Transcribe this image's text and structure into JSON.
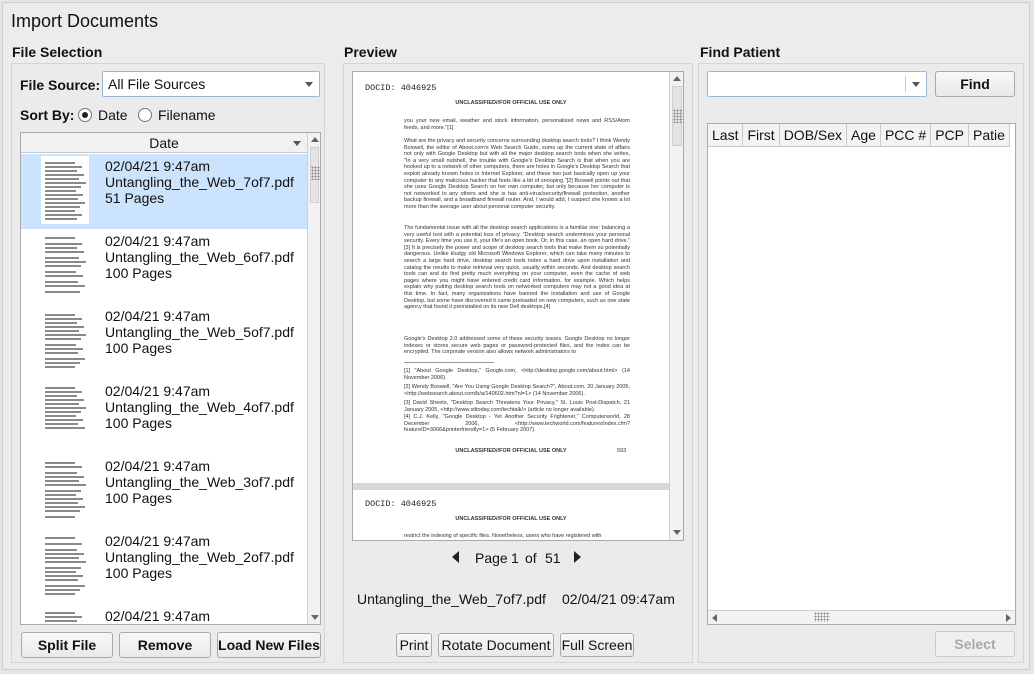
{
  "window": {
    "title": "Import Documents"
  },
  "file_selection": {
    "title": "File Selection",
    "source_label": "File Source:",
    "source_value": "All File Sources",
    "sort_label": "Sort By:",
    "sort_options": [
      "Date",
      "Filename"
    ],
    "sort_selected": "Date",
    "list_header": "Date",
    "files": [
      {
        "date": "02/04/21 9:47am",
        "name": "Untangling_the_Web_7of7.pdf",
        "pages": "51 Pages"
      },
      {
        "date": "02/04/21 9:47am",
        "name": "Untangling_the_Web_6of7.pdf",
        "pages": "100 Pages"
      },
      {
        "date": "02/04/21 9:47am",
        "name": "Untangling_the_Web_5of7.pdf",
        "pages": "100 Pages"
      },
      {
        "date": "02/04/21 9:47am",
        "name": "Untangling_the_Web_4of7.pdf",
        "pages": "100 Pages"
      },
      {
        "date": "02/04/21 9:47am",
        "name": "Untangling_the_Web_3of7.pdf",
        "pages": "100 Pages"
      },
      {
        "date": "02/04/21 9:47am",
        "name": "Untangling_the_Web_2of7.pdf",
        "pages": "100 Pages"
      },
      {
        "date": "02/04/21 9:47am",
        "name": "",
        "pages": ""
      }
    ],
    "buttons": {
      "split": "Split File",
      "remove": "Remove",
      "load": "Load New Files"
    }
  },
  "preview": {
    "title": "Preview",
    "docid": "DOCID: 4046925",
    "classification": "UNCLASSIFIED//FOR OFFICIAL USE ONLY",
    "p_intro": "you your new email, weather and stock information, personalized news and RSS/Atom feeds, and more.\"[1]",
    "p1": "What are the privacy and security concerns surrounding desktop search tools? I think Wendy Boswell, the editor of About.com's Web Search Guide, sums up the current state of affairs not only with Google Desktop but with all the major desktop search tools when she writes, \"In a very small nutshell, the trouble with Google's Desktop Search is that when you are hooked up to a network of other computers, there are holes in Google's Desktop Search that exploit already known holes in Internet Explorer, and these two just basically open up your computer to any malicious hacker that feels like a bit of snooping.\"[2] Boswell points out that she uses Google Desktop Search on her own computer, but only because her computer is not networked to any others and she is has anti-virus/security/firewall protection, another backup firewall, and a broadband firewall router. And, I would add, I suspect she knows a lot more than the average user about personal computer security.",
    "p2": "The fundamental issue with all the desktop search applications is a familiar one: balancing a very useful tool with a potential loss of privacy. \"Desktop search undermines your personal security. Every time you use it, your life's an open book. Or, in this case, an open hard drive.\"[3] It is precisely the power and scope of desktop search tools that make them so potentially dangerous. Unlike kludgy old Microsoft Windows Explorer, which can take many minutes to search a large hard drive, desktop search tools index a hard drive upon installation and catalog the results to make retrieval very quick, usually within seconds. And desktop search tools can and do find pretty much everything on your computer, even the cache of web pages where you might have entered credit card information, for example. Which helps explain why putting desktop search tools on networked computers may not a good idea at this time. In fact, many organizations have banned the installation and use of Google Desktop, but some have discovered it came preloaded on new computers, such as one state agency that found it preinstalled on its new Dell desktops.[4]",
    "p3": "Google's Desktop 2.0 addressed some of these security issues. Google Desktop no longer indexes or stores secure web pages or password-protected files, and the index can be encrypted. The corporate version also allows network administrators to",
    "footnotes": [
      "[1] \"About Google Desktop,\" Google.com, <http://desktop.google.com/about.html> (14 November 2006).",
      "[2] Wendy Boswell, \"Are You Using Google Desktop Search?\", About.com, 20 January 2005, <http://websearch.about.com/b/a/140602.htm?nl=1> (14 November 2006).",
      "[3] David Sheets, \"Desktop Search Threatens Your Privacy,\" St. Louis Post-Dispatch, 21 January 2005, <http://www.stltoday.com/techtalk/> (article no longer available).",
      "[4] C.J. Kelly, \"Google Desktop - Yet Another Security Frightener,\" Computerworld, 28 December 2006, <http://www.techworld.com/features/index.cfm?featureID=3066&printerfriendly=1> (5 February 2007)."
    ],
    "page_number": "593",
    "page2_text": "restrict the indexing of specific files. Nonetheless, users who have registered with",
    "page_label": "Page",
    "page_current": "1",
    "page_of": "of",
    "page_total": "51",
    "filename": "Untangling_the_Web_7of7.pdf",
    "timestamp": "02/04/21 09:47am",
    "buttons": {
      "print": "Print",
      "rotate": "Rotate Document",
      "fullscreen": "Full Screen"
    }
  },
  "find_patient": {
    "title": "Find Patient",
    "search_value": "",
    "find_label": "Find",
    "columns": [
      "Last",
      "First",
      "DOB/Sex",
      "Age",
      "PCC #",
      "PCP",
      "Patie"
    ],
    "select_label": "Select"
  }
}
